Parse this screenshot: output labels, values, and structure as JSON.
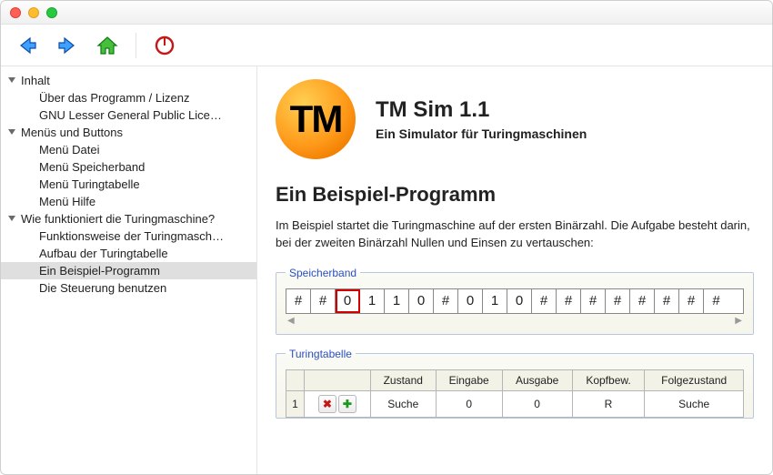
{
  "toolbar": {
    "back": "back",
    "forward": "forward",
    "home": "home",
    "power": "power"
  },
  "tree": {
    "g1": "Inhalt",
    "g1_items": [
      "Über das Programm / Lizenz",
      "GNU Lesser General Public Lice…"
    ],
    "g2": "Menüs und Buttons",
    "g2_items": [
      "Menü Datei",
      "Menü Speicherband",
      "Menü Turingtabelle",
      "Menü Hilfe"
    ],
    "g3": "Wie funktioniert die Turingmaschine?",
    "g3_items": [
      "Funktionsweise der Turingmasch…",
      "Aufbau der Turingtabelle",
      "Ein Beispiel-Programm",
      "Die Steuerung benutzen"
    ],
    "selected": "Ein Beispiel-Programm"
  },
  "hero": {
    "logo": "TM",
    "title": "TM Sim 1.1",
    "subtitle": "Ein Simulator für Turingmaschinen"
  },
  "page": {
    "heading": "Ein Beispiel-Programm",
    "intro": "Im Beispiel startet die Turingmaschine auf der ersten Binärzahl. Die Aufgabe besteht darin, bei der zweiten Binärzahl Nullen und Einsen zu vertauschen:"
  },
  "tape": {
    "legend": "Speicherband",
    "cells": [
      "#",
      "#",
      "0",
      "1",
      "1",
      "0",
      "#",
      "0",
      "1",
      "0",
      "#",
      "#",
      "#",
      "#",
      "#",
      "#",
      "#",
      "#"
    ],
    "head_index": 2,
    "scroll_left": "◀",
    "scroll_right": "▶"
  },
  "table": {
    "legend": "Turingtabelle",
    "headers": [
      "Zustand",
      "Eingabe",
      "Ausgabe",
      "Kopfbew.",
      "Folgezustand"
    ],
    "rows": [
      {
        "n": "1",
        "cells": [
          "Suche",
          "0",
          "0",
          "R",
          "Suche"
        ]
      }
    ],
    "delete_icon": "✖",
    "add_icon": "✚"
  }
}
